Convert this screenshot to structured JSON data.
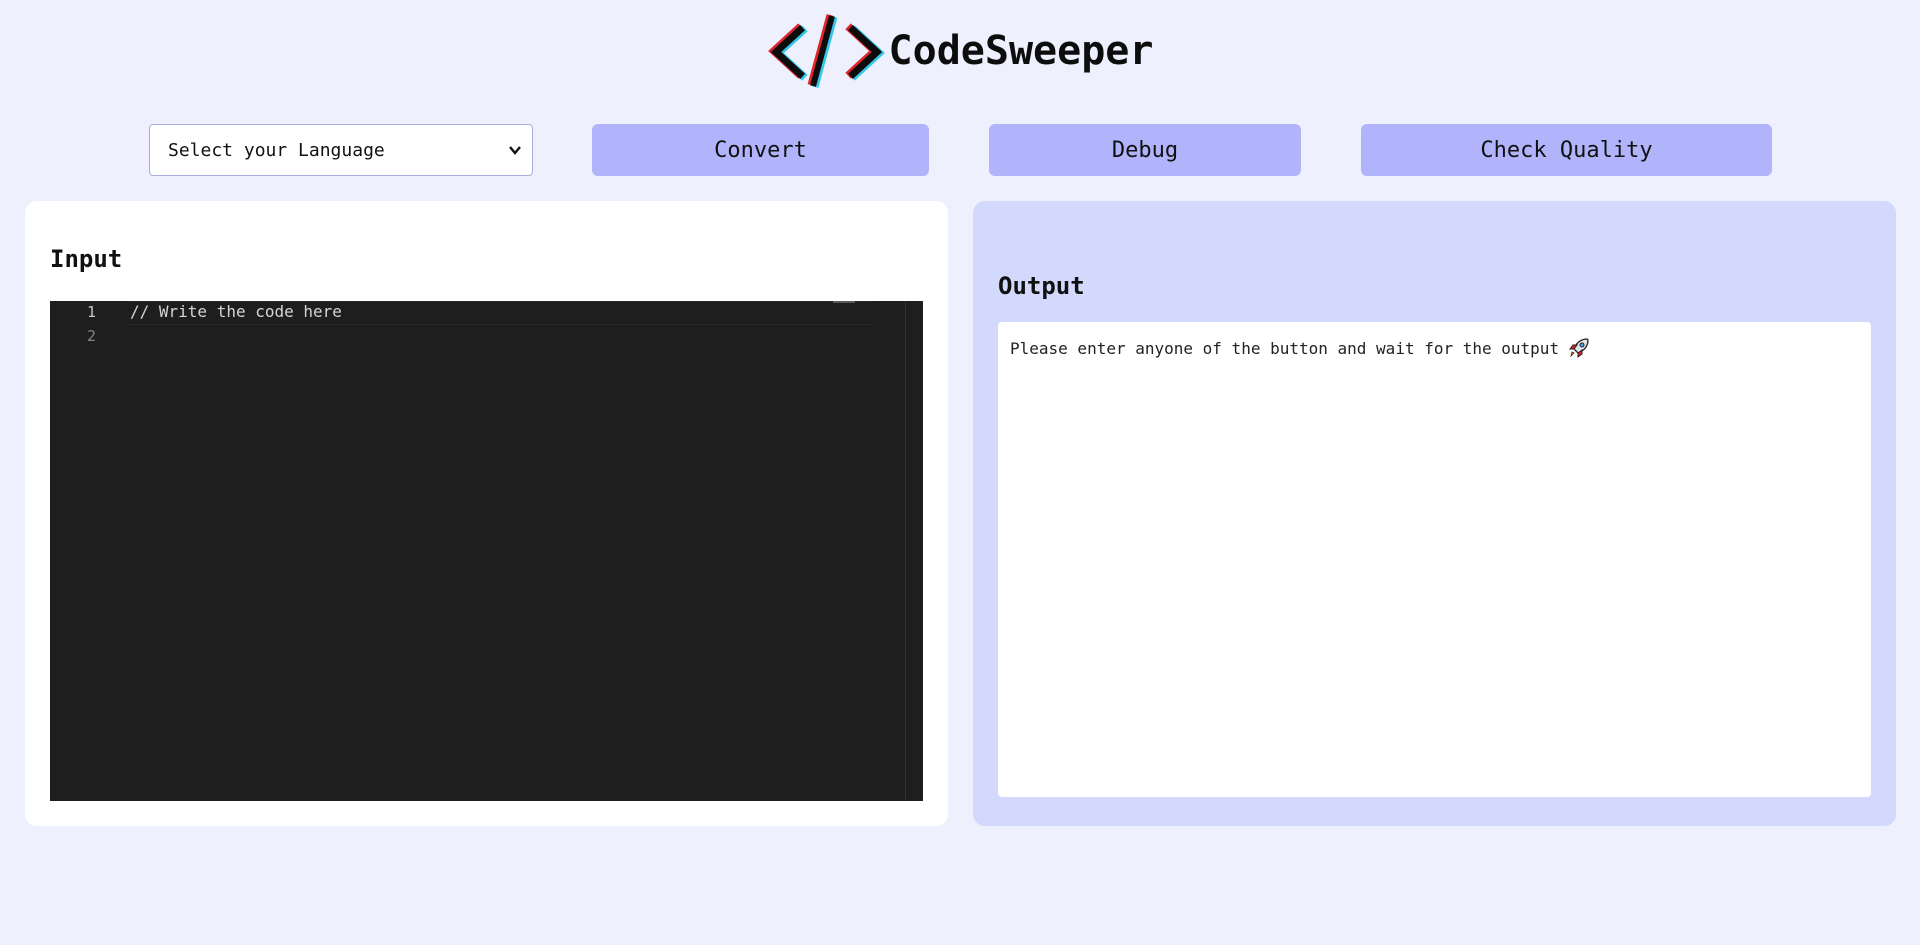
{
  "header": {
    "title": "CodeSweeper",
    "logo_icon": "code-brackets-icon"
  },
  "toolbar": {
    "language_select": {
      "selected": "Select your Language",
      "options": [
        "Select your Language"
      ]
    },
    "convert_label": "Convert",
    "debug_label": "Debug",
    "quality_label": "Check Quality"
  },
  "input_panel": {
    "heading": "Input",
    "editor": {
      "line_numbers": [
        "1",
        "2"
      ],
      "lines": [
        "// Write the code here",
        ""
      ]
    }
  },
  "output_panel": {
    "heading": "Output",
    "message": "Please enter anyone of the button and wait for the output",
    "message_icon": "rocket-icon"
  },
  "colors": {
    "page_bg": "#eef0fe",
    "button_bg": "#b1b3fb",
    "output_panel_bg": "#d3d8fd",
    "editor_bg": "#1e1e1e",
    "logo_red": "#e0242b",
    "logo_cyan": "#33c7e8"
  }
}
